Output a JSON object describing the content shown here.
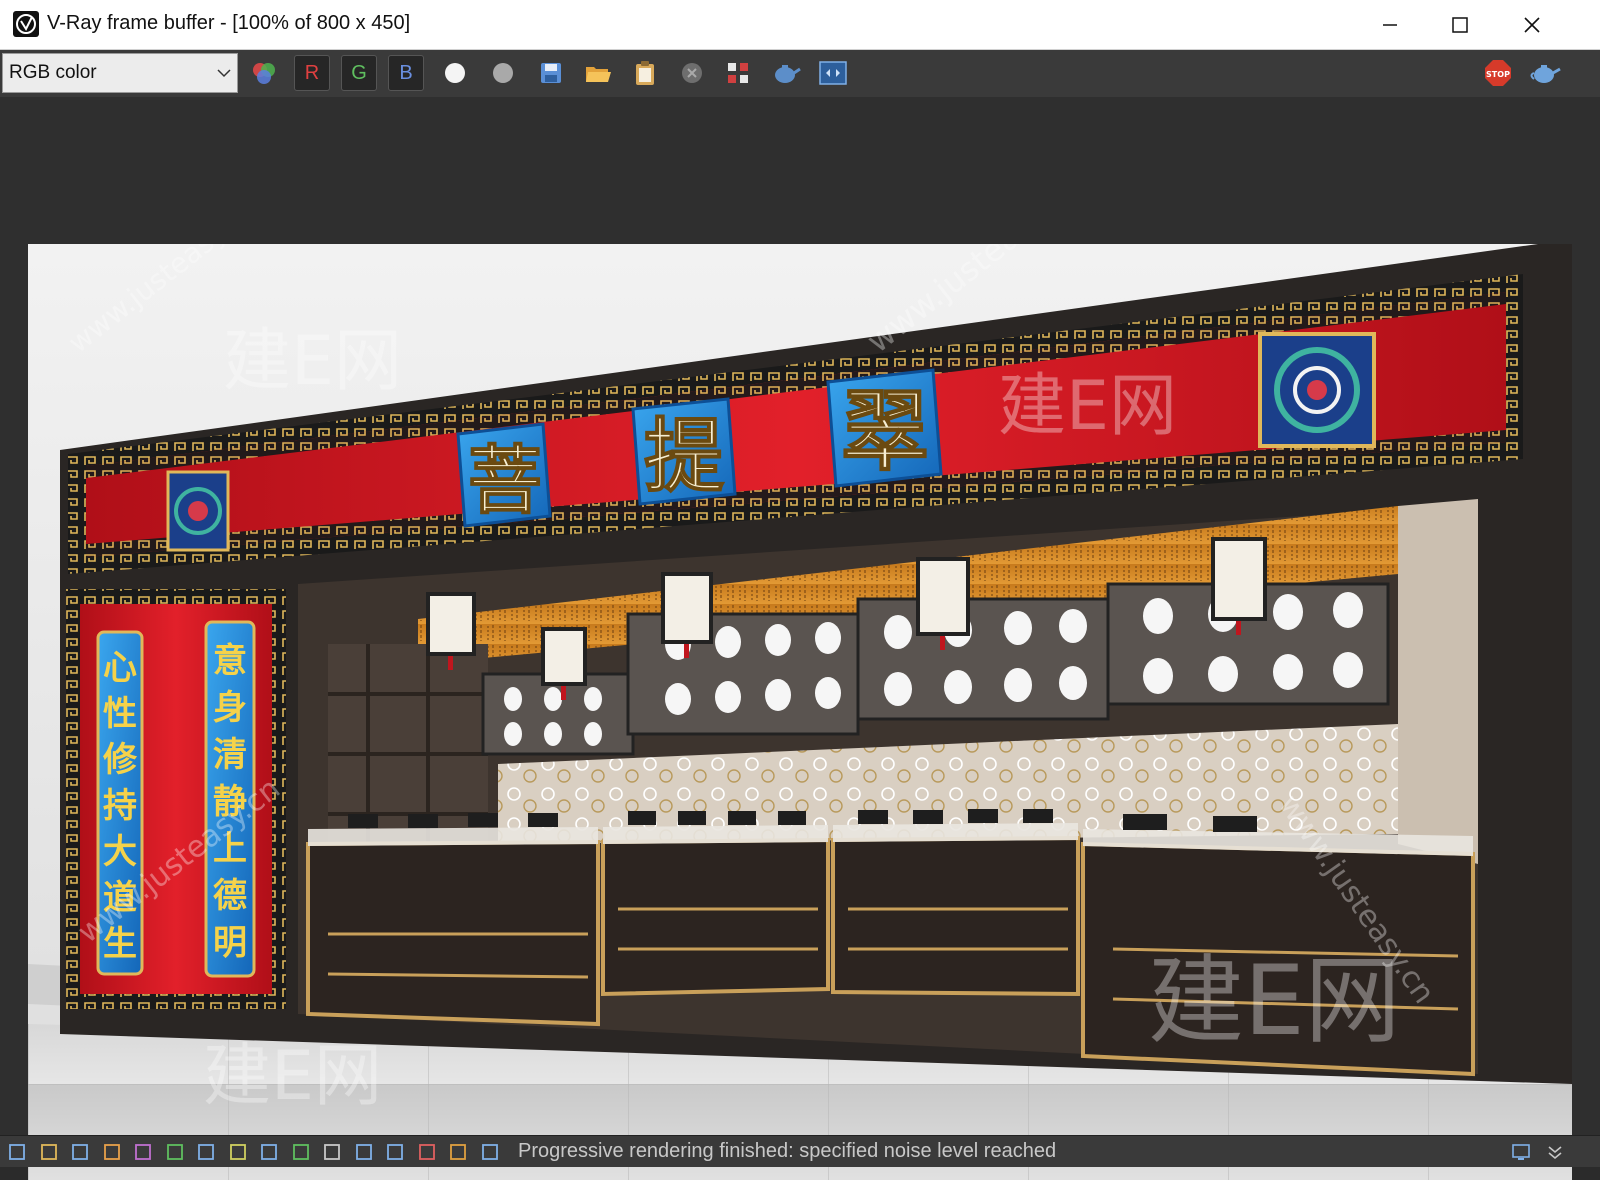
{
  "window": {
    "title": "V-Ray frame buffer - [100% of 800 x 450]",
    "controls": [
      "minimize",
      "maximize",
      "close"
    ]
  },
  "toolbar": {
    "channel_select_value": "RGB color",
    "channel_buttons": [
      {
        "label": "R",
        "color": "#e04040"
      },
      {
        "label": "G",
        "color": "#5fbf5f"
      },
      {
        "label": "B",
        "color": "#6a8fe0"
      }
    ],
    "icons": [
      "channels-icon",
      "white-dot-icon",
      "grey-dot-icon",
      "save-icon",
      "open-folder-icon",
      "clipboard-icon",
      "clear-icon",
      "region-render-icon",
      "render-teapot-icon",
      "vfb-history-icon",
      "stop-render-icon",
      "teapot-icon"
    ],
    "stop_label": "STOP"
  },
  "render": {
    "sign_characters": [
      "菩",
      "提",
      "翠"
    ],
    "couplet_left": [
      "心",
      "性",
      "修",
      "持",
      "大",
      "道",
      "生"
    ],
    "couplet_right": [
      "意",
      "身",
      "清",
      "静",
      "上",
      "德",
      "明"
    ],
    "watermark_cn": "建E网",
    "watermark_url": "www.justeasy.cn",
    "colors": {
      "facade_red": "#c8141e",
      "sign_blue": "#1d86d6",
      "trim_gold": "#d9b25a",
      "counter_dark": "#2c2420"
    }
  },
  "statusbar": {
    "message": "Progressive rendering finished: specified noise level reached",
    "icons": [
      "display-icon",
      "levels-icon",
      "info-icon",
      "color-corr-icon",
      "hsl-icon",
      "curves-icon",
      "histogram-icon",
      "exposure-icon",
      "lens-icon",
      "bg-icon",
      "curve-icon",
      "lut-icon",
      "h-icon",
      "link-icon",
      "stereo-icon",
      "ocio-icon"
    ]
  }
}
